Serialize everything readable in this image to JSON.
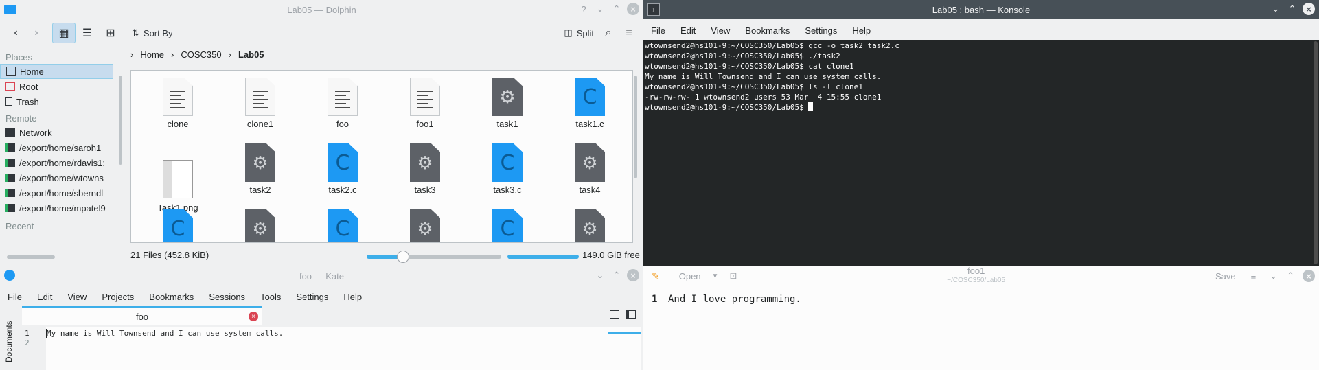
{
  "dolphin": {
    "title": "Lab05 — Dolphin",
    "toolbar": {
      "sort_label": "Sort By",
      "split_label": "Split"
    },
    "places": {
      "header_places": "Places",
      "items": [
        "Home",
        "Root",
        "Trash"
      ],
      "header_remote": "Remote",
      "remote_items": [
        "Network",
        "/export/home/saroh1",
        "/export/home/rdavis1:",
        "/export/home/wtowns",
        "/export/home/sberndl",
        "/export/home/mpatel9"
      ],
      "header_recent": "Recent"
    },
    "breadcrumb": [
      "Home",
      "COSC350",
      "Lab05"
    ],
    "files": [
      {
        "name": "clone",
        "type": "doc"
      },
      {
        "name": "clone1",
        "type": "doc"
      },
      {
        "name": "foo",
        "type": "doc"
      },
      {
        "name": "foo1",
        "type": "doc"
      },
      {
        "name": "task1",
        "type": "exe"
      },
      {
        "name": "task1.c",
        "type": "c"
      },
      {
        "name": "Task1.png",
        "type": "png"
      },
      {
        "name": "task2",
        "type": "exe"
      },
      {
        "name": "task2.c",
        "type": "c"
      },
      {
        "name": "task3",
        "type": "exe"
      },
      {
        "name": "task3.c",
        "type": "c"
      },
      {
        "name": "task4",
        "type": "exe"
      },
      {
        "name": "",
        "type": "c"
      },
      {
        "name": "",
        "type": "exe"
      },
      {
        "name": "",
        "type": "c"
      },
      {
        "name": "",
        "type": "exe"
      },
      {
        "name": "",
        "type": "c"
      },
      {
        "name": "",
        "type": "exe"
      }
    ],
    "status": "21 Files (452.8 KiB)",
    "free_space": "149.0 GiB free"
  },
  "konsole": {
    "title": "Lab05 : bash — Konsole",
    "menu": [
      "File",
      "Edit",
      "View",
      "Bookmarks",
      "Settings",
      "Help"
    ],
    "lines": [
      "wtownsend2@hs101-9:~/COSC350/Lab05$ gcc -o task2 task2.c",
      "wtownsend2@hs101-9:~/COSC350/Lab05$ ./task2",
      "wtownsend2@hs101-9:~/COSC350/Lab05$ cat clone1",
      "My name is Will Townsend and I can use system calls.",
      "wtownsend2@hs101-9:~/COSC350/Lab05$ ls -l clone1",
      "-rw-rw-rw- 1 wtownsend2 users 53 Mar  4 15:55 clone1",
      "wtownsend2@hs101-9:~/COSC350/Lab05$ "
    ]
  },
  "kate": {
    "title": "foo — Kate",
    "menu": [
      "File",
      "Edit",
      "View",
      "Projects",
      "Bookmarks",
      "Sessions",
      "Tools",
      "Settings",
      "Help"
    ],
    "tab": "foo",
    "side_tab": "Documents",
    "line_numbers": [
      "1",
      "2"
    ],
    "lines": [
      "My name is Will Townsend and I can use system calls.",
      ""
    ]
  },
  "kwrite": {
    "title": "foo1",
    "subtitle": "~/COSC350/Lab05",
    "open_label": "Open",
    "save_label": "Save",
    "line_number": "1",
    "line": "And I love programming."
  },
  "colors": {
    "accent": "#3daee9",
    "titlebar_active": "#475057",
    "terminal_bg": "#232627"
  }
}
